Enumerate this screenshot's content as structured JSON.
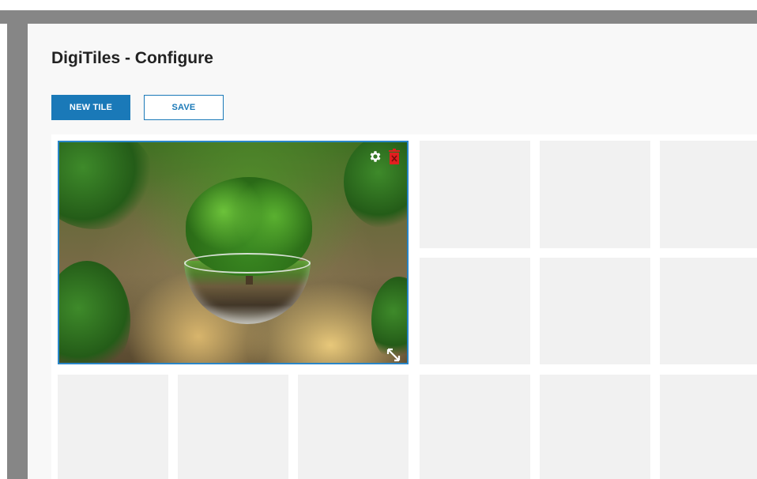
{
  "header": {
    "title": "DigiTiles - Configure"
  },
  "toolbar": {
    "new_tile_label": "NEW TILE",
    "save_label": "SAVE"
  },
  "tile_controls": {
    "settings_icon": "gear-icon",
    "delete_icon": "trash-icon",
    "resize_icon": "resize-diagonal-icon"
  },
  "colors": {
    "accent": "#1a79b8",
    "tile_border": "#2a86c8",
    "delete": "#e02020",
    "empty_tile": "#f1f1f1"
  }
}
